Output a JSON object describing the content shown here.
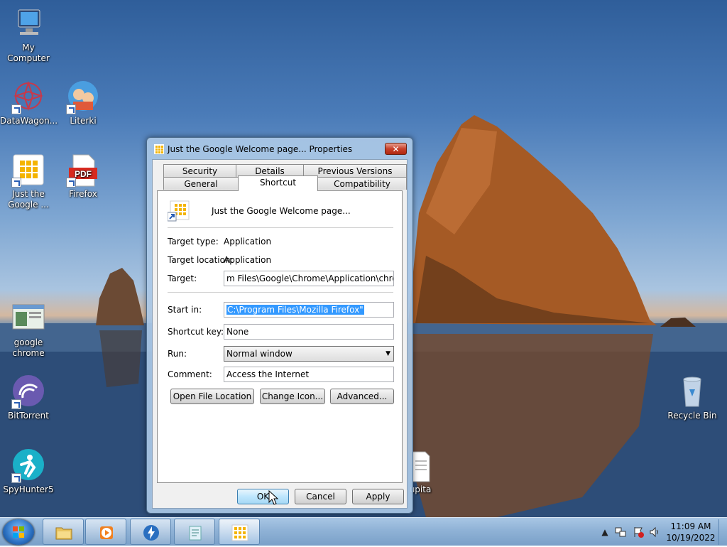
{
  "desktop": {
    "icons": [
      {
        "label": "My Computer"
      },
      {
        "label": "DataWagon..."
      },
      {
        "label": "Literki"
      },
      {
        "label": "Just the Google ..."
      },
      {
        "label": "Firefox"
      },
      {
        "label": "google chrome"
      },
      {
        "label": "BitTorrent"
      },
      {
        "label": "SpyHunter5"
      },
      {
        "label": "Recycle Bin"
      },
      {
        "label": "upita"
      }
    ],
    "pdf_icon_text": "PDF"
  },
  "dialog": {
    "title": "Just the Google Welcome page... Properties",
    "close_label": "✕",
    "tabs": {
      "security": "Security",
      "details": "Details",
      "previous_versions": "Previous Versions",
      "general": "General",
      "shortcut": "Shortcut",
      "compatibility": "Compatibility"
    },
    "shortcut_name": "Just the Google Welcome page...",
    "target_type_label": "Target type:",
    "target_type_value": "Application",
    "target_location_label": "Target location:",
    "target_location_value": "Application",
    "target_label": "Target:",
    "target_value": "m Files\\Google\\Chrome\\Application\\chrome.exe\"",
    "start_in_label": "Start in:",
    "start_in_value": "C:\\Program Files\\Mozilla Firefox\"",
    "shortcut_key_label": "Shortcut key:",
    "shortcut_key_value": "None",
    "run_label": "Run:",
    "run_value": "Normal window",
    "comment_label": "Comment:",
    "comment_value": "Access the Internet",
    "open_file_location": "Open File Location",
    "change_icon": "Change Icon...",
    "advanced": "Advanced...",
    "ok": "OK",
    "cancel": "Cancel",
    "apply": "Apply"
  },
  "taskbar": {
    "time": "11:09 AM",
    "date": "10/19/2022"
  }
}
